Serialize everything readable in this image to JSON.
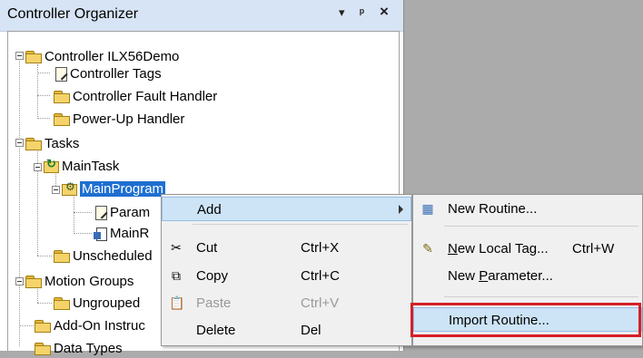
{
  "panel": {
    "title": "Controller Organizer",
    "dropdown_glyph": "▾",
    "pin_glyph": "ᵖ",
    "close_glyph": "×"
  },
  "tree": {
    "controller": "Controller ILX56Demo",
    "controller_tags": "Controller Tags",
    "fault_handler": "Controller Fault Handler",
    "powerup_handler": "Power-Up Handler",
    "tasks": "Tasks",
    "main_task": "MainTask",
    "main_program": "MainProgram",
    "parameters": "Param",
    "main_routine": "MainR",
    "unscheduled": "Unscheduled",
    "motion_groups": "Motion Groups",
    "ungrouped": "Ungrouped",
    "addon": "Add-On Instruc",
    "data_types": "Data Types"
  },
  "context_menu": {
    "add": "Add",
    "cut": "Cut",
    "cut_shortcut": "Ctrl+X",
    "copy": "Copy",
    "copy_shortcut": "Ctrl+C",
    "paste": "Paste",
    "paste_shortcut": "Ctrl+V",
    "delete": "Delete",
    "delete_shortcut": "Del"
  },
  "submenu": {
    "new_routine": "New Routine...",
    "new_local_tag_pre": "",
    "new_local_tag_u": "N",
    "new_local_tag_post": "ew Local Tag...",
    "new_local_tag_shortcut": "Ctrl+W",
    "new_parameter_pre": "New ",
    "new_parameter_u": "P",
    "new_parameter_post": "arameter...",
    "import_routine": "Import Routine..."
  },
  "colors": {
    "header_bg": "#d6e4f5",
    "selection": "#1f6fd1",
    "hover": "#cde4f7",
    "highlight_border": "#d52027"
  }
}
